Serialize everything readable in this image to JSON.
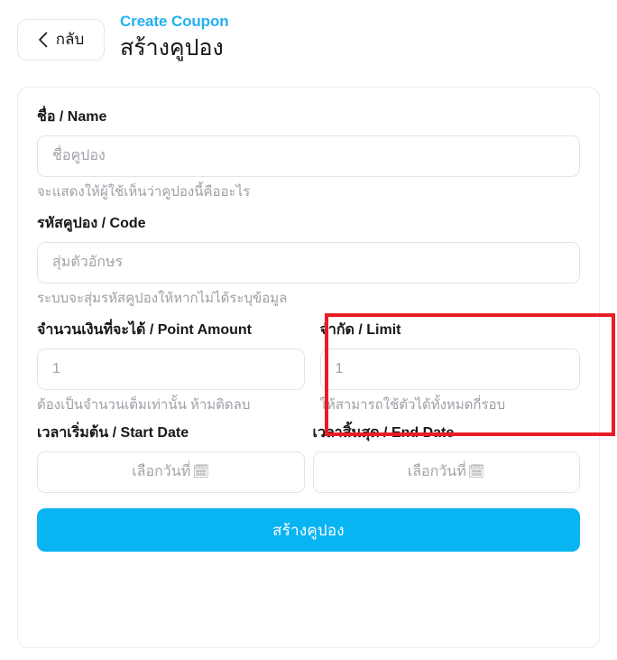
{
  "header": {
    "back_label": "กลับ",
    "back_icon": "chevron-left-icon",
    "title_en": "Create Coupon",
    "title_th": "สร้างคูปอง",
    "accent_color": "#22b1f0"
  },
  "form": {
    "name": {
      "label": "ชื่อ / Name",
      "value": "",
      "placeholder": "ชื่อคูปอง",
      "helper": "จะแสดงให้ผู้ใช้เห็นว่าคูปองนี้คืออะไร"
    },
    "code": {
      "label": "รหัสคูปอง / Code",
      "value": "",
      "placeholder": "สุ่มตัวอักษร",
      "helper": "ระบบจะสุ่มรหัสคูปองให้หากไม่ได้ระบุข้อมูล"
    },
    "point_amount": {
      "label": "จำนวนเงินที่จะได้ / Point Amount",
      "value": "",
      "placeholder": "1",
      "helper": "ต้องเป็นจำนวนเต็มเท่านั้น ห้ามติดลบ"
    },
    "limit": {
      "label": "จำกัด / Limit",
      "value": "",
      "placeholder": "1",
      "helper": "ให้สามารถใช้ตัวได้ทั้งหมดกี่รอบ",
      "highlighted": true,
      "highlight_color": "#e81d23"
    },
    "start_date": {
      "label": "เวลาเริ่มต้น / Start Date",
      "placeholder": "เลือกวันที่",
      "icon": "calendar-icon",
      "icon_glyph": "🗓"
    },
    "end_date": {
      "label": "เวลาสิ้นสุด / End Date",
      "placeholder": "เลือกวันที่",
      "icon": "calendar-icon",
      "icon_glyph": "🗓"
    },
    "submit": {
      "label": "สร้างคูปอง",
      "color": "#09b4f2"
    }
  }
}
